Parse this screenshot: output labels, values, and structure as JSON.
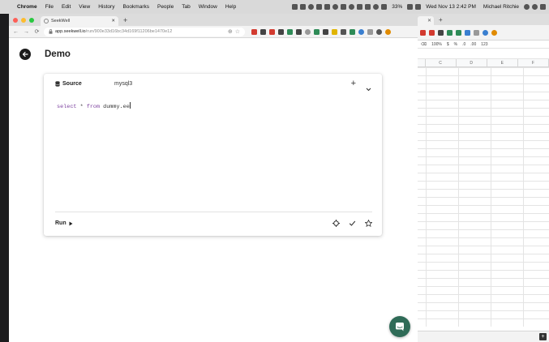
{
  "menubar": {
    "app": "Chrome",
    "items": [
      "File",
      "Edit",
      "View",
      "History",
      "Bookmarks",
      "People",
      "Tab",
      "Window",
      "Help"
    ],
    "battery": "33%",
    "datetime": "Wed Nov 13  2:42 PM",
    "user": "Michael Ritchie"
  },
  "browser": {
    "tab_title": "SeekWell",
    "url_host": "app.seekwell.io",
    "url_path": "/run/900e33d16bc34d169f11206be1470e12"
  },
  "page": {
    "title": "Demo",
    "card": {
      "source_label": "Source",
      "db_name": "mysql3",
      "query": {
        "keyword1": "select",
        "middle": " * ",
        "keyword2": "from",
        "table": " dummy.ee"
      },
      "run_label": "Run"
    }
  },
  "bg_sheet": {
    "zoom": "100%",
    "currency": "$",
    "percent": "%",
    "dec1": ".0",
    "dec2": ".00",
    "format": "123",
    "columns": [
      "C",
      "D",
      "E",
      "F"
    ]
  },
  "colors": {
    "chat_button": "#2f6b57",
    "keyword": "#7a3e9d"
  }
}
